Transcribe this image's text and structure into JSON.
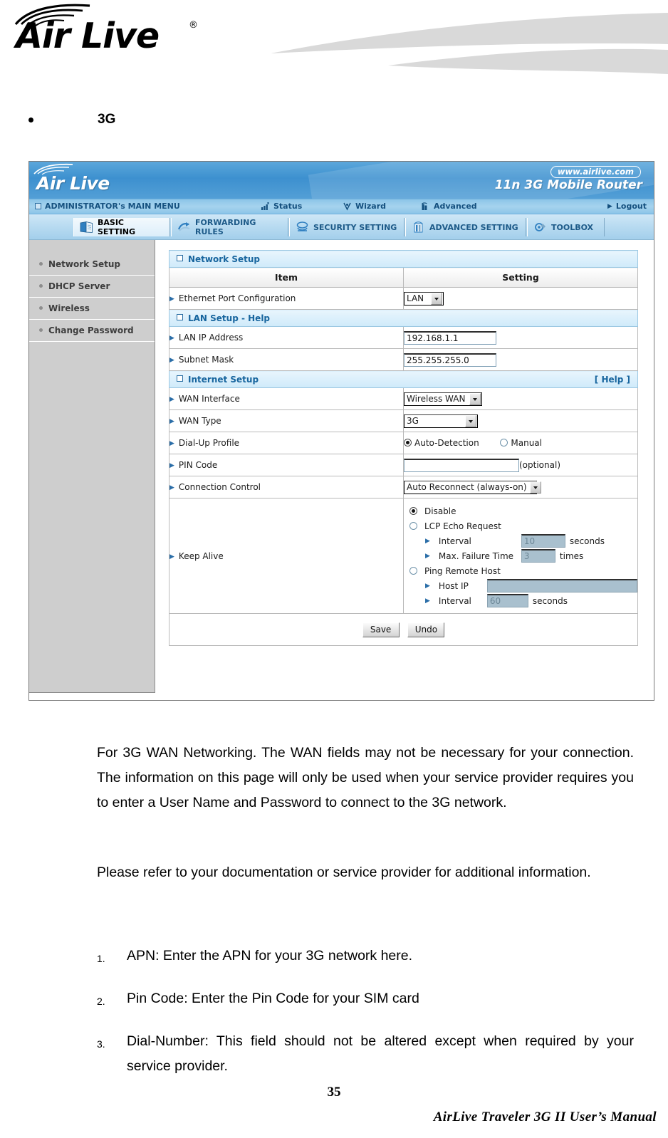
{
  "document": {
    "brand": "Air Live",
    "brand_registered": "®",
    "bullet_heading": "3G",
    "page_number": "35",
    "footer": "AirLive  Traveler  3G  II  User’s  Manual",
    "paragraphs": [
      "For 3G WAN Networking. The WAN fields may not be necessary for your connection. The information on this page will only be used when your service provider requires you to enter a User Name and Password to connect to the 3G network.",
      "Please refer to your documentation or service provider for additional information."
    ],
    "numbered_list": [
      {
        "num": "1.",
        "text": "APN: Enter the APN for your 3G network here."
      },
      {
        "num": "2.",
        "text": "Pin Code: Enter the Pin Code for your SIM card"
      },
      {
        "num": "3.",
        "text": "Dial-Number: This field should not be altered except when required by your service provider."
      }
    ]
  },
  "router_ui": {
    "brand": "Air Live",
    "brand_tick": "’",
    "url_badge": "www.airlive.com",
    "model": "11n 3G Mobile Router",
    "nav": {
      "main_menu": "ADMINISTRATOR's MAIN MENU",
      "status": "Status",
      "wizard": "Wizard",
      "advanced": "Advanced",
      "logout": "Logout"
    },
    "tabs": [
      {
        "label": "BASIC SETTING",
        "icon": "book-icon",
        "active": true
      },
      {
        "label": "FORWARDING RULES",
        "icon": "forward-icon",
        "active": false
      },
      {
        "label": "SECURITY SETTING",
        "icon": "shield-icon",
        "active": false
      },
      {
        "label": "ADVANCED SETTING",
        "icon": "tower-icon",
        "active": false
      },
      {
        "label": "TOOLBOX",
        "icon": "toolbox-icon",
        "active": false
      }
    ],
    "sidebar": [
      {
        "label": "Network Setup"
      },
      {
        "label": "DHCP Server"
      },
      {
        "label": "Wireless"
      },
      {
        "label": "Change Password"
      }
    ],
    "sections": {
      "network_setup": "Network Setup",
      "lan_setup_help": "LAN Setup - Help",
      "internet_setup": "Internet Setup",
      "help_link": "[ Help ]"
    },
    "columns": {
      "item": "Item",
      "setting": "Setting"
    },
    "rows": {
      "ethernet_port_configuration": {
        "label": "Ethernet Port Configuration",
        "value": "LAN"
      },
      "lan_ip_address": {
        "label": "LAN IP Address",
        "value": "192.168.1.1"
      },
      "subnet_mask": {
        "label": "Subnet Mask",
        "value": "255.255.255.0"
      },
      "wan_interface": {
        "label": "WAN Interface",
        "value": "Wireless WAN"
      },
      "wan_type": {
        "label": "WAN Type",
        "value": "3G"
      },
      "dial_up_profile": {
        "label": "Dial-Up Profile",
        "option_auto": "Auto-Detection",
        "option_manual": "Manual",
        "selected": "Auto-Detection"
      },
      "pin_code": {
        "label": "PIN Code",
        "value": "",
        "suffix": "(optional)"
      },
      "connection_control": {
        "label": "Connection Control",
        "value": "Auto Reconnect (always-on)"
      },
      "keep_alive": {
        "label": "Keep Alive",
        "selected": "Disable",
        "opt_disable": "Disable",
        "opt_lcp": "LCP Echo Request",
        "lcp_interval_label": "Interval",
        "lcp_interval_value": "10",
        "lcp_interval_unit": "seconds",
        "max_failure_label": "Max. Failure Time",
        "max_failure_value": "3",
        "max_failure_unit": "times",
        "opt_ping": "Ping Remote Host",
        "host_ip_label": "Host IP",
        "host_ip_value": "",
        "ping_interval_label": "Interval",
        "ping_interval_value": "60",
        "ping_interval_unit": "seconds"
      }
    },
    "buttons": {
      "save": "Save",
      "undo": "Undo"
    },
    "colors": {
      "brand_blue": "#3d90cf",
      "nav_blue": "#a6d3ee",
      "section_header_text": "#17659e",
      "sidebar_gray": "#cecece",
      "disabled_field": "#a9c0ce"
    }
  }
}
